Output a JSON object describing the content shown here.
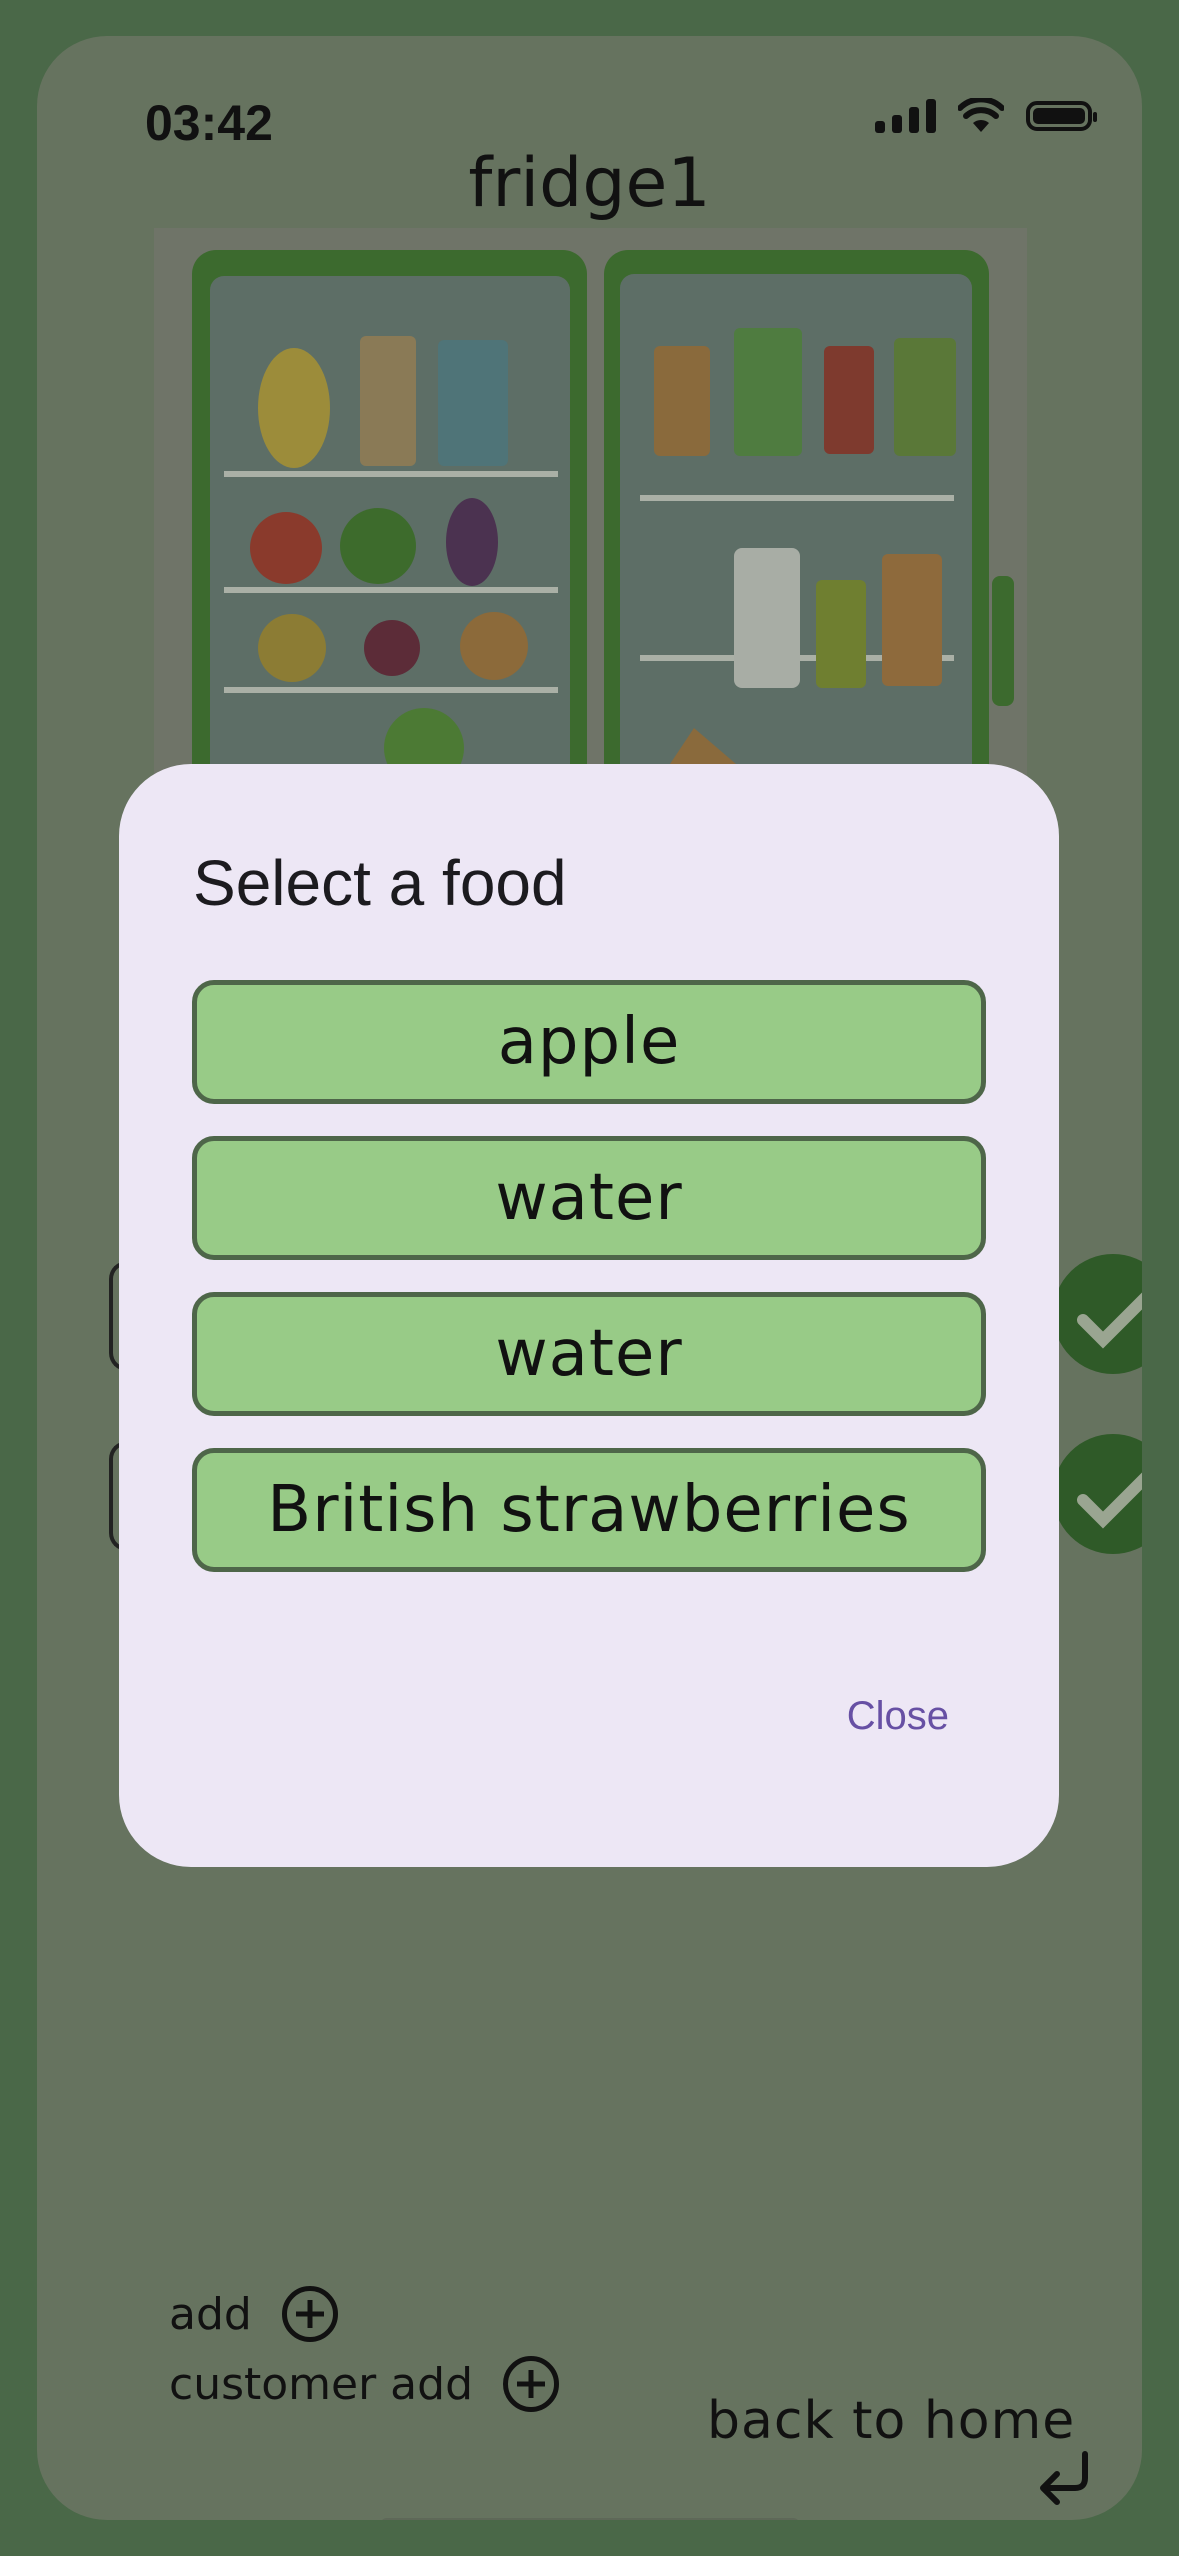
{
  "status_bar": {
    "time": "03:42"
  },
  "page": {
    "title": "fridge1"
  },
  "fridge_image": {
    "alt": "fridge"
  },
  "dialog": {
    "title": "Select a food",
    "foods": [
      "apple",
      "water",
      "water",
      "British strawberries"
    ],
    "close_label": "Close"
  },
  "bottom_actions": {
    "add_label": "add",
    "customer_add_label": "customer add",
    "back_label": "back to home"
  },
  "colors": {
    "overlay_bg": "#66735f",
    "dialog_bg": "#ede7f5",
    "food_button": "#98cb87",
    "accent": "#6750a4",
    "check_green": "#2f5a28"
  },
  "icons": [
    "signal-icon",
    "wifi-icon",
    "battery-icon",
    "check-icon",
    "plus-circle-icon",
    "return-icon"
  ]
}
